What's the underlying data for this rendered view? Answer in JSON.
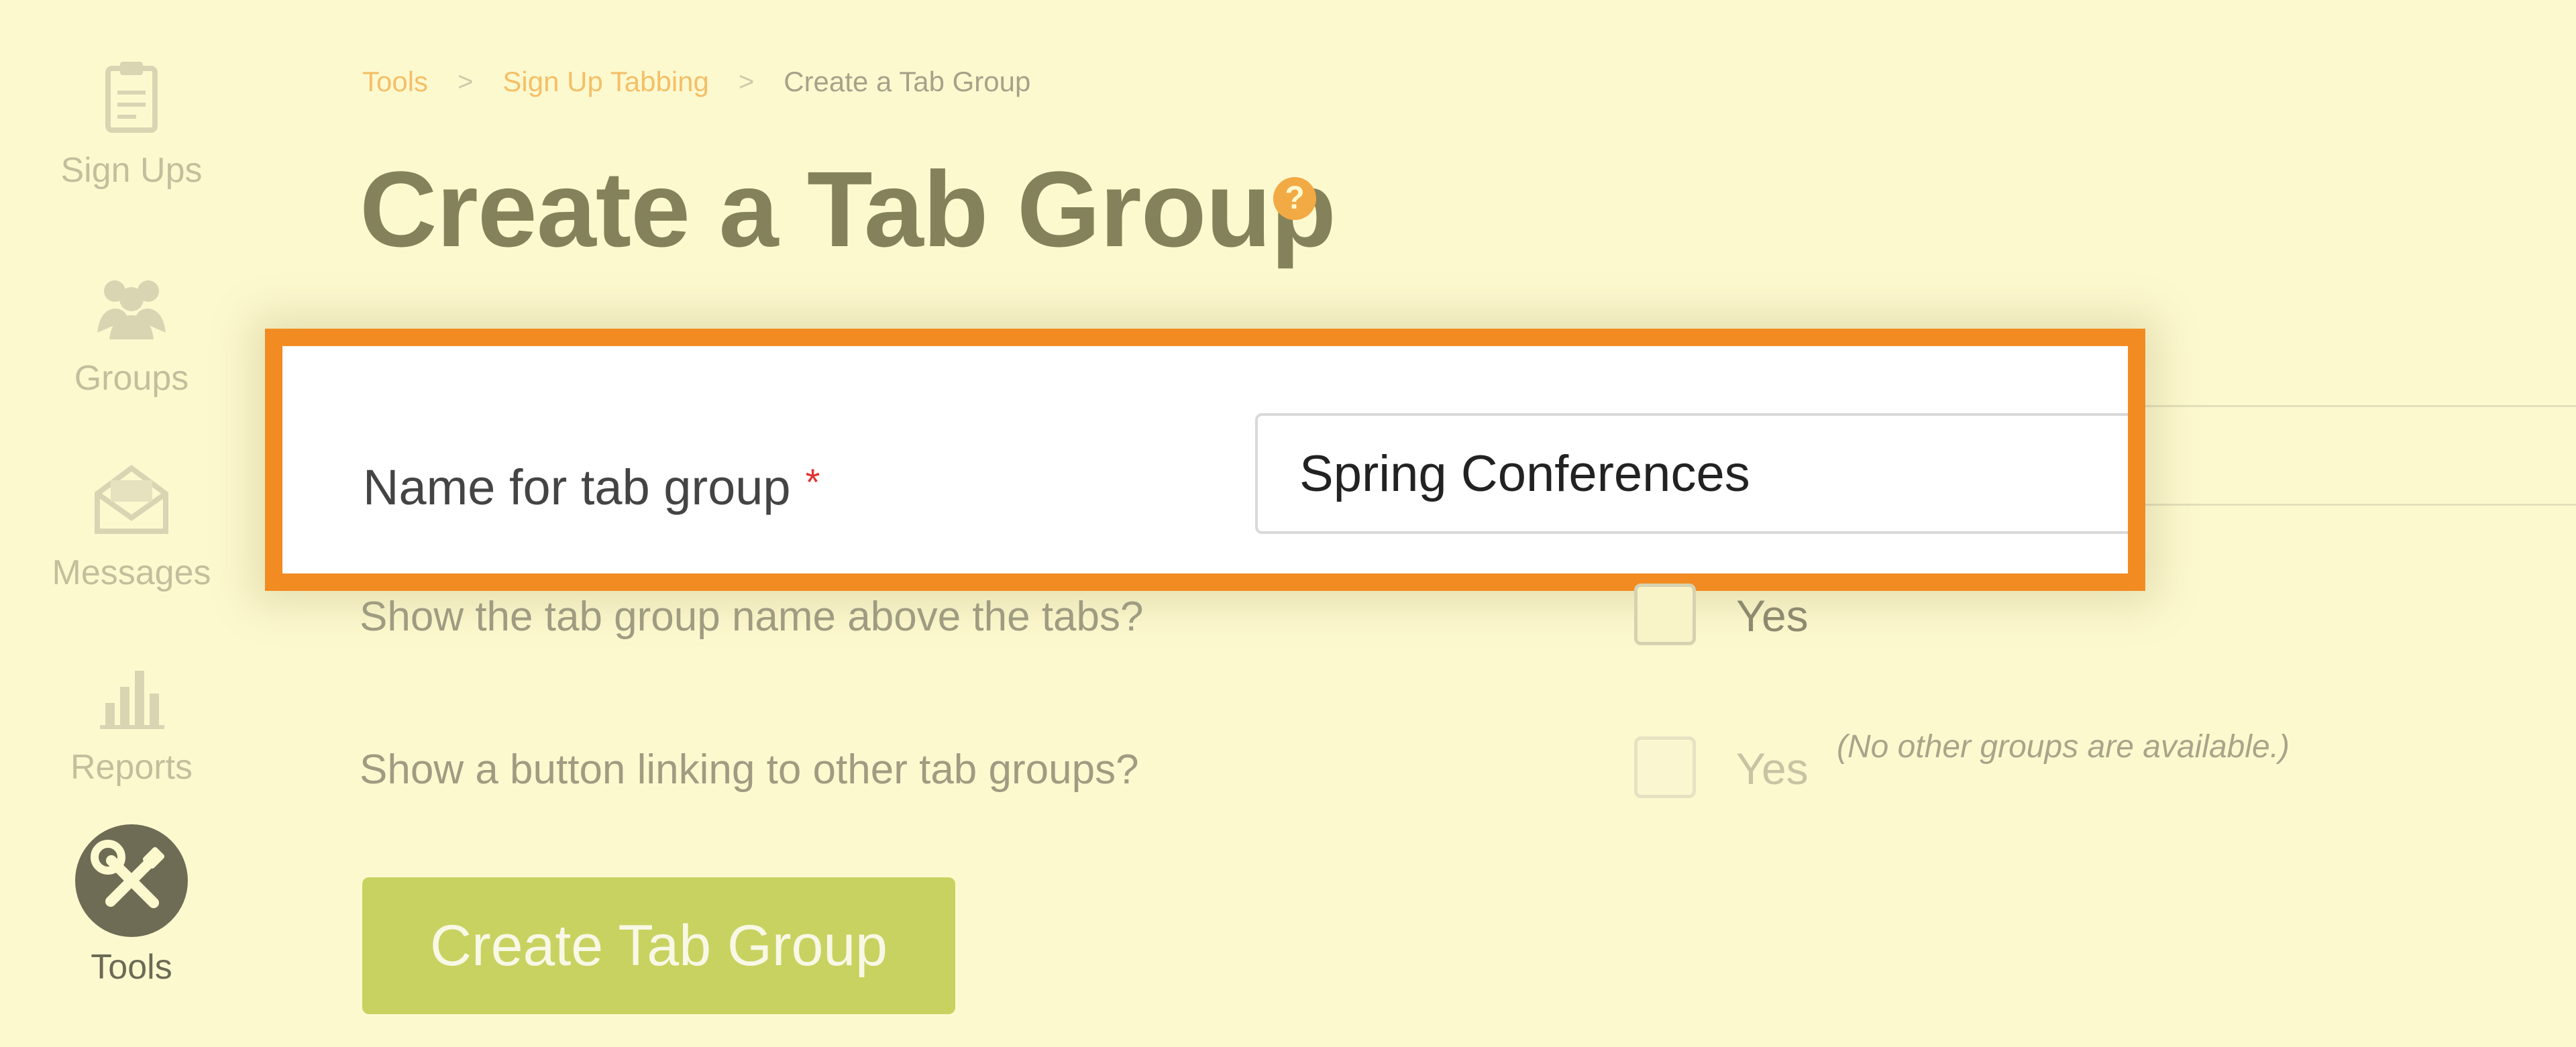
{
  "sidebar": {
    "items": [
      {
        "label": "Sign Ups",
        "icon": "clipboard-icon"
      },
      {
        "label": "Groups",
        "icon": "people-icon"
      },
      {
        "label": "Messages",
        "icon": "envelope-icon"
      },
      {
        "label": "Reports",
        "icon": "bar-chart-icon"
      },
      {
        "label": "Tools",
        "icon": "wrench-screwdriver-icon",
        "active": true
      }
    ]
  },
  "breadcrumb": {
    "items": [
      {
        "label": "Tools",
        "link": true
      },
      {
        "label": "Sign Up Tabbing",
        "link": true
      },
      {
        "label": "Create a Tab Group",
        "link": false
      }
    ],
    "separator": ">"
  },
  "page": {
    "title": "Create a Tab Group",
    "help_icon": "?"
  },
  "form": {
    "name_field": {
      "label": "Name for tab group",
      "required_marker": "*",
      "value": "Spring Conferences"
    },
    "show_name": {
      "label": "Show the tab group name above the tabs?",
      "option_label": "Yes",
      "checked": false
    },
    "show_button": {
      "label": "Show a button linking to other tab groups?",
      "option_label": "Yes",
      "checked": false,
      "disabled": true,
      "note": "(No other groups are available.)"
    },
    "submit_label": "Create Tab Group"
  },
  "colors": {
    "background": "#fdf9cf",
    "highlight_border": "#f28b22",
    "button": "#c8d260",
    "breadcrumb_link": "#f4bf68",
    "required": "#e0332e"
  }
}
